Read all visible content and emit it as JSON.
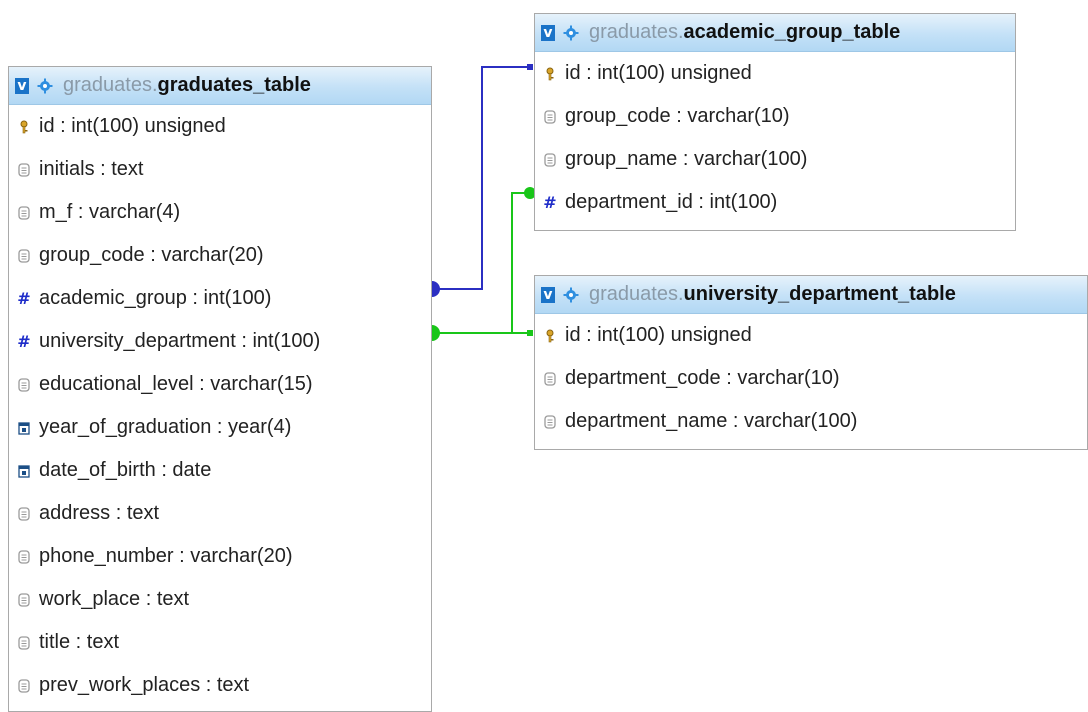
{
  "tables": {
    "graduates": {
      "db": "graduates",
      "name": "graduates_table",
      "columns": [
        {
          "icon": "key-icon",
          "text": "id : int(100) unsigned"
        },
        {
          "icon": "text-column-icon",
          "text": "initials : text"
        },
        {
          "icon": "text-column-icon",
          "text": "m_f : varchar(4)"
        },
        {
          "icon": "text-column-icon",
          "text": "group_code : varchar(20)"
        },
        {
          "icon": "numeric-column-icon",
          "text": "academic_group : int(100)"
        },
        {
          "icon": "numeric-column-icon",
          "text": "university_department : int(100)"
        },
        {
          "icon": "text-column-icon",
          "text": "educational_level : varchar(15)"
        },
        {
          "icon": "date-column-icon",
          "text": "year_of_graduation : year(4)"
        },
        {
          "icon": "date-column-icon",
          "text": "date_of_birth : date"
        },
        {
          "icon": "text-column-icon",
          "text": "address : text"
        },
        {
          "icon": "text-column-icon",
          "text": "phone_number : varchar(20)"
        },
        {
          "icon": "text-column-icon",
          "text": "work_place : text"
        },
        {
          "icon": "text-column-icon",
          "text": "title : text"
        },
        {
          "icon": "text-column-icon",
          "text": "prev_work_places : text"
        }
      ]
    },
    "academic_group": {
      "db": "graduates",
      "name": "academic_group_table",
      "columns": [
        {
          "icon": "key-icon",
          "text": "id : int(100) unsigned"
        },
        {
          "icon": "text-column-icon",
          "text": "group_code : varchar(10)"
        },
        {
          "icon": "text-column-icon",
          "text": "group_name : varchar(100)"
        },
        {
          "icon": "numeric-column-icon",
          "text": "department_id : int(100)"
        }
      ]
    },
    "university_department": {
      "db": "graduates",
      "name": "university_department_table",
      "columns": [
        {
          "icon": "key-icon",
          "text": "id : int(100) unsigned"
        },
        {
          "icon": "text-column-icon",
          "text": "department_code : varchar(10)"
        },
        {
          "icon": "text-column-icon",
          "text": "department_name : varchar(100)"
        }
      ]
    }
  },
  "toggle_label": "v",
  "colors": {
    "relation_academic_group": "#2b2fc2",
    "relation_university_department": "#19c619",
    "header_top": "#e6f2fb",
    "header_bottom": "#b2d8f4",
    "numeric_icon": "#1f2dc9"
  }
}
